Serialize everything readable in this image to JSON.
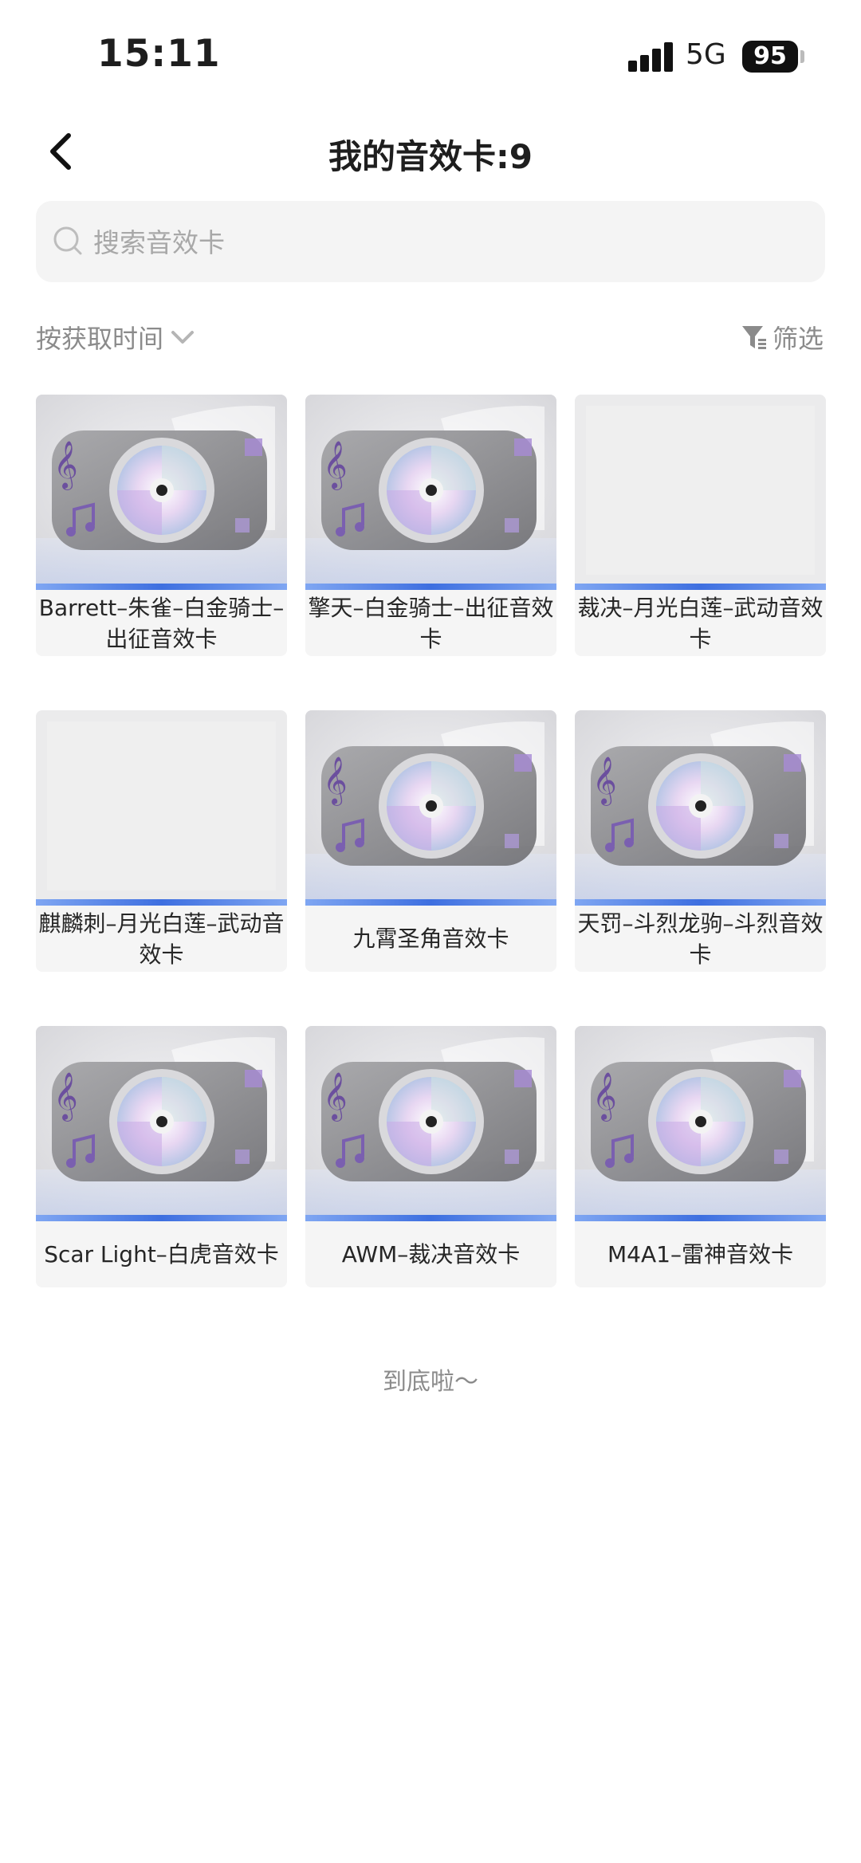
{
  "status_bar": {
    "time": "15:11",
    "network": "5G",
    "battery": "95"
  },
  "header": {
    "title": "我的音效卡:9",
    "back_icon": "chevron-left-icon"
  },
  "search": {
    "placeholder": "搜索音效卡",
    "value": ""
  },
  "toolbar": {
    "sort_label": "按获取时间",
    "filter_label": "筛选"
  },
  "cards": [
    {
      "label": "Barrett–朱雀–白金骑士–出征音效卡",
      "thumbnail": "music-disc"
    },
    {
      "label": "擎天–白金骑士–出征音效卡",
      "thumbnail": "music-disc"
    },
    {
      "label": "裁决–月光白莲–武动音效卡",
      "thumbnail": "blank"
    },
    {
      "label": "麒麟刺–月光白莲–武动音效卡",
      "thumbnail": "blank"
    },
    {
      "label": "九霄圣角音效卡",
      "thumbnail": "music-disc"
    },
    {
      "label": "天罚–斗烈龙驹–斗烈音效卡",
      "thumbnail": "music-disc"
    },
    {
      "label": "Scar Light–白虎音效卡",
      "thumbnail": "music-disc"
    },
    {
      "label": "AWM–裁决音效卡",
      "thumbnail": "music-disc"
    },
    {
      "label": "M4A1–雷神音效卡",
      "thumbnail": "music-disc"
    }
  ],
  "footer": {
    "end_text": "到底啦～"
  },
  "colors": {
    "accent_bar": "#3e6fe0",
    "card_bg": "#f5f5f5",
    "muted_text": "#8b8b8b"
  }
}
